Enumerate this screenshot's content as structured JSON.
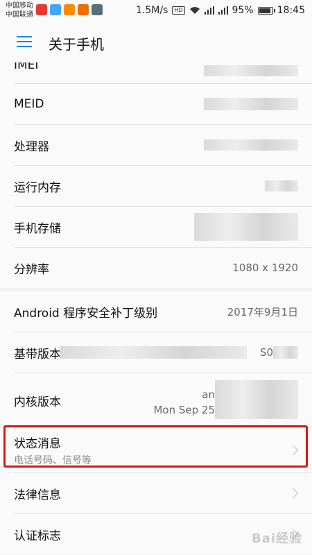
{
  "status_bar": {
    "carrier_1": "中国移动",
    "carrier_2": "中国联通",
    "speed": "1.5M/s",
    "hd_badge": "HD",
    "battery_level": 0.95,
    "battery": "95%",
    "time": "18:45"
  },
  "app_bar": {
    "title": "关于手机",
    "menu_icon": "menu-icon"
  },
  "rows": {
    "imei": {
      "label": "IMEI"
    },
    "meid": {
      "label": "MEID"
    },
    "processor": {
      "label": "处理器"
    },
    "ram": {
      "label": "运行内存"
    },
    "storage": {
      "label": "手机存储"
    },
    "resolution": {
      "label": "分辨率",
      "value": "1080 x 1920"
    },
    "security_patch": {
      "label": "Android 程序安全补丁级别",
      "value": "2017年9月1日"
    },
    "baseband": {
      "label": "基带版本",
      "value_fragment": "S0"
    },
    "kernel": {
      "label": "内核版本",
      "value_line1": "an",
      "value_line2": "Mon Sep 25"
    },
    "status": {
      "label": "状态消息",
      "sublabel": "电话号码、信号等"
    },
    "legal": {
      "label": "法律信息"
    },
    "certification": {
      "label": "认证标志"
    }
  },
  "colors": {
    "accent": "#1e88e5",
    "highlight_border": "#d41a1a"
  },
  "watermark": "Bai经验"
}
